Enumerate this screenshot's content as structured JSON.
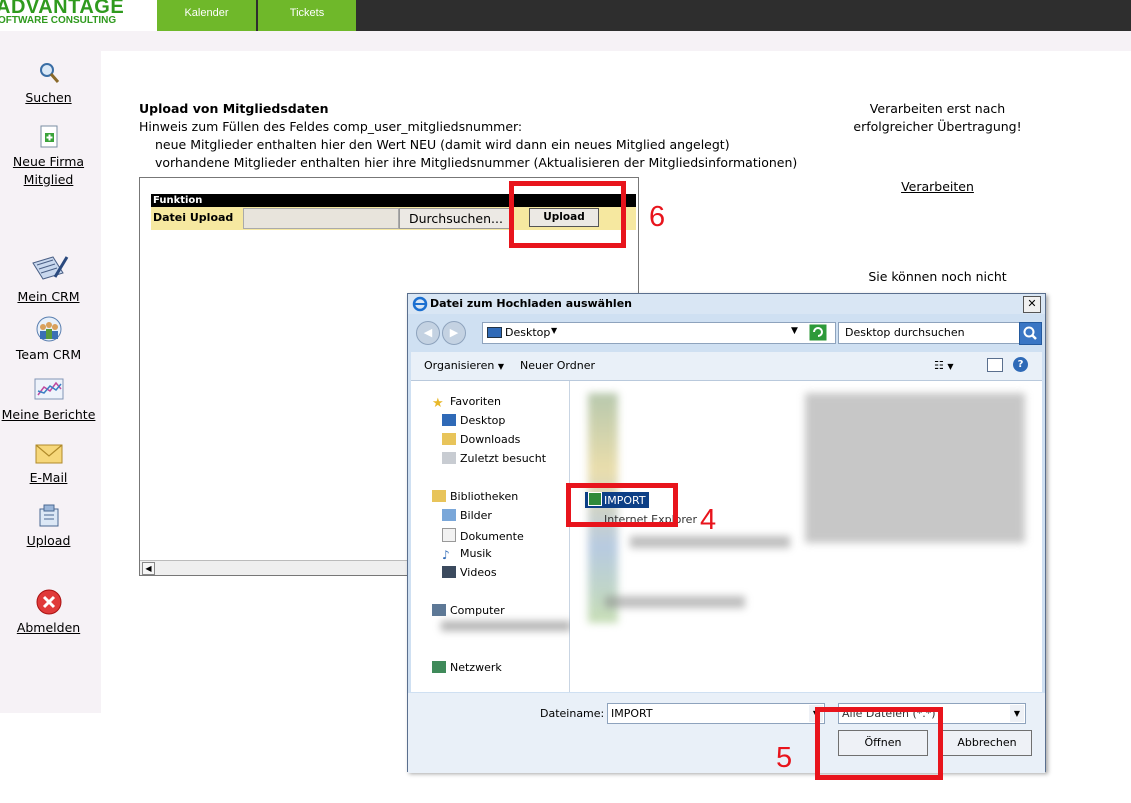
{
  "header": {
    "logo_main": "ADVANTAGE",
    "logo_sub": "OFTWARE CONSULTING",
    "tabs": [
      {
        "label": "Kalender"
      },
      {
        "label": "Tickets"
      }
    ]
  },
  "sidebar": {
    "items": [
      {
        "label": "Suchen",
        "icon": "magnifier-icon"
      },
      {
        "label": "Neue Firma",
        "label2": "Mitglied",
        "icon": "new-document-icon"
      },
      {
        "label": "Mein CRM",
        "icon": "pen-document-icon"
      },
      {
        "label": "Team CRM",
        "icon": "team-icon"
      },
      {
        "label": "Meine Berichte",
        "icon": "chart-icon"
      },
      {
        "label": "E-Mail",
        "icon": "envelope-icon"
      },
      {
        "label": "Upload",
        "icon": "upload-icon"
      },
      {
        "label": "Abmelden",
        "icon": "close-icon"
      }
    ]
  },
  "content": {
    "title": "Upload von Mitgliedsdaten",
    "hint": "Hinweis zum Füllen des Feldes comp_user_mitgliedsnummer:",
    "line1": "neue Mitglieder enthalten hier den Wert NEU (damit wird dann ein neues Mitglied angelegt)",
    "line2": "vorhandene Mitglieder enthalten  hier ihre Mitgliedsnummer (Aktualisieren der Mitgliedsinformationen)",
    "right_note_1": "Verarbeiten erst nach",
    "right_note_2": "erfolgreicher Übertragung!",
    "process_link": "Verarbeiten",
    "right_note_3": "Sie können noch nicht",
    "function_header": "Funktion",
    "upload_label": "Datei Upload",
    "browse_button": "Durchsuchen...",
    "upload_button": "Upload"
  },
  "annotations": {
    "step4": "4",
    "step5": "5",
    "step6": "6",
    "color": "#e8141c"
  },
  "dialog": {
    "title": "Datei zum Hochladen auswählen",
    "address": "Desktop",
    "search_placeholder": "Desktop durchsuchen",
    "toolbar": {
      "organize": "Organisieren",
      "new_folder": "Neuer Ordner"
    },
    "tree": {
      "favorites": "Favoriten",
      "desktop": "Desktop",
      "downloads": "Downloads",
      "recent": "Zuletzt besucht",
      "libraries": "Bibliotheken",
      "pictures": "Bilder",
      "documents": "Dokumente",
      "music": "Musik",
      "videos": "Videos",
      "computer": "Computer",
      "network": "Netzwerk"
    },
    "selected_file": "IMPORT",
    "partial_item": "Internet Explorer",
    "filename_label": "Dateiname:",
    "filename_value": "IMPORT",
    "filetype_value": "Alle Dateien (*.*)",
    "open_button": "Öffnen",
    "cancel_button": "Abbrechen"
  }
}
